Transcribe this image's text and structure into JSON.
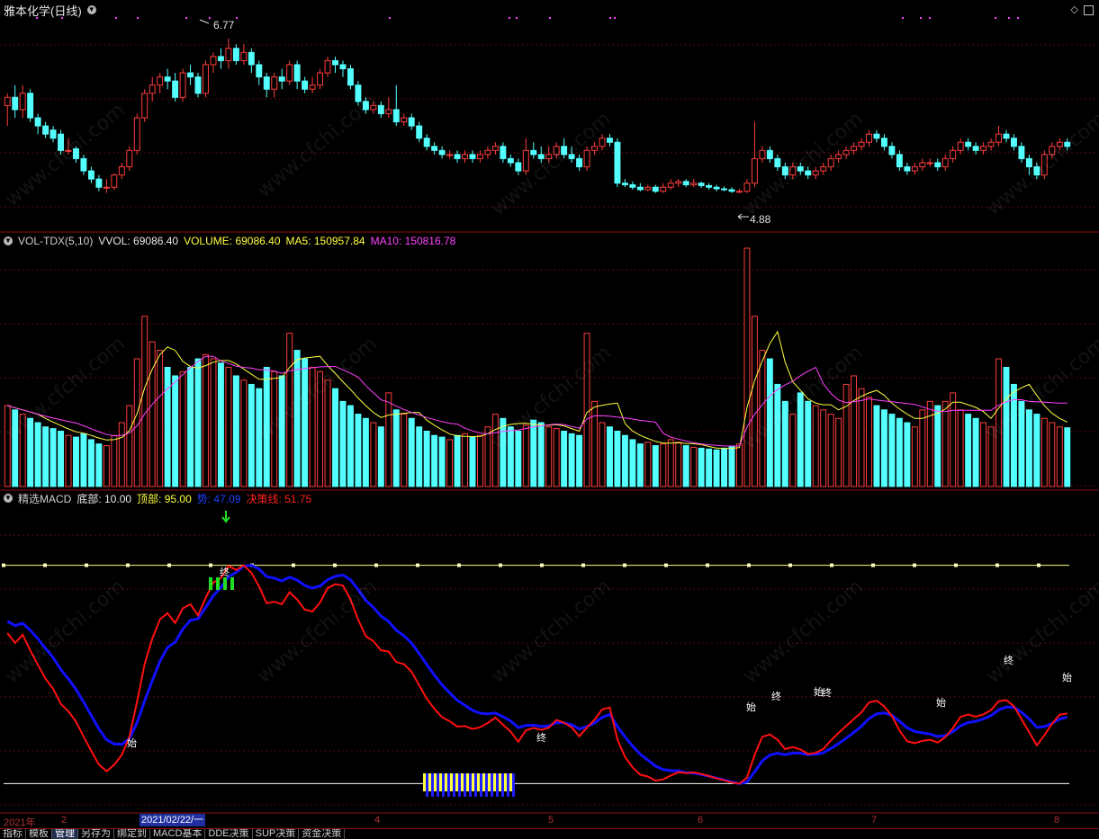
{
  "price_panel": {
    "title": "雅本化学(日线)",
    "high_label": "6.77",
    "low_label": "4.88"
  },
  "vol_panel": {
    "title": "VOL-TDX(5,10)",
    "vvol": "VVOL: 69086.40",
    "volume": "VOLUME: 69086.40",
    "ma5": "MA5: 150957.84",
    "ma10": "MA10: 150816.78"
  },
  "macd_panel": {
    "title": "精选MACD",
    "bottom": "底部: 10.00",
    "top": "顶部: 95.00",
    "trend": "势: 47.09",
    "decision": "决策线: 51.75",
    "start_mark": "始",
    "end_mark": "终"
  },
  "date_axis": {
    "labels": [
      "2021年",
      "2",
      "4",
      "5",
      "6",
      "7",
      "8"
    ],
    "selected": "2021/02/22/一"
  },
  "tabs": [
    "指标",
    "模板",
    "管理",
    "另存为",
    "绑定到",
    "MACD基本",
    "DDE决策",
    "SUP决策",
    "资金决策"
  ],
  "watermark": "www.cfchi.com",
  "colors": {
    "up": "#ff3c3c",
    "down": "#54ffff",
    "ma5": "#ffff40",
    "ma10": "#ff40ff",
    "trend": "#1010ff",
    "decision": "#ff1010",
    "axis": "#8b1010"
  },
  "chart_data": [
    {
      "type": "candlestick",
      "title": "雅本化学(日线)",
      "ylim": [
        4.6,
        7.0
      ],
      "candles": [
        [
          5.95,
          6.05,
          5.7,
          6.1
        ],
        [
          6.05,
          5.9,
          5.8,
          6.2
        ],
        [
          5.9,
          6.1,
          5.8,
          6.2
        ],
        [
          6.1,
          5.8,
          5.75,
          6.15
        ],
        [
          5.8,
          5.7,
          5.6,
          5.85
        ],
        [
          5.7,
          5.6,
          5.55,
          5.75
        ],
        [
          5.65,
          5.55,
          5.5,
          5.7
        ],
        [
          5.6,
          5.4,
          5.35,
          5.65
        ],
        [
          5.4,
          5.4,
          5.35,
          5.55
        ],
        [
          5.42,
          5.3,
          5.25,
          5.45
        ],
        [
          5.3,
          5.15,
          5.1,
          5.35
        ],
        [
          5.15,
          5.05,
          5.0,
          5.2
        ],
        [
          5.05,
          4.95,
          4.9,
          5.1
        ],
        [
          4.95,
          4.95,
          4.88,
          5.05
        ],
        [
          4.95,
          5.1,
          4.92,
          5.12
        ],
        [
          5.1,
          5.2,
          5.05,
          5.25
        ],
        [
          5.2,
          5.4,
          5.15,
          5.45
        ],
        [
          5.4,
          5.8,
          5.35,
          5.85
        ],
        [
          5.8,
          6.1,
          5.75,
          6.15
        ],
        [
          6.1,
          6.2,
          6.0,
          6.3
        ],
        [
          6.2,
          6.3,
          6.1,
          6.35
        ],
        [
          6.3,
          6.25,
          6.15,
          6.4
        ],
        [
          6.25,
          6.05,
          6.0,
          6.35
        ],
        [
          6.05,
          6.35,
          6.0,
          6.4
        ],
        [
          6.35,
          6.3,
          6.2,
          6.45
        ],
        [
          6.3,
          6.1,
          6.05,
          6.35
        ],
        [
          6.1,
          6.45,
          6.05,
          6.5
        ],
        [
          6.45,
          6.55,
          6.35,
          6.6
        ],
        [
          6.55,
          6.5,
          6.4,
          6.65
        ],
        [
          6.5,
          6.65,
          6.4,
          6.77
        ],
        [
          6.65,
          6.5,
          6.45,
          6.7
        ],
        [
          6.5,
          6.6,
          6.45,
          6.7
        ],
        [
          6.6,
          6.45,
          6.35,
          6.65
        ],
        [
          6.45,
          6.3,
          6.2,
          6.5
        ],
        [
          6.3,
          6.15,
          6.05,
          6.35
        ],
        [
          6.15,
          6.3,
          6.05,
          6.35
        ],
        [
          6.3,
          6.25,
          6.15,
          6.4
        ],
        [
          6.25,
          6.45,
          6.2,
          6.5
        ],
        [
          6.45,
          6.25,
          6.15,
          6.5
        ],
        [
          6.25,
          6.15,
          6.1,
          6.3
        ],
        [
          6.15,
          6.2,
          6.1,
          6.3
        ],
        [
          6.2,
          6.35,
          6.15,
          6.4
        ],
        [
          6.35,
          6.5,
          6.3,
          6.55
        ],
        [
          6.5,
          6.45,
          6.35,
          6.55
        ],
        [
          6.45,
          6.4,
          6.3,
          6.5
        ],
        [
          6.4,
          6.2,
          6.15,
          6.45
        ],
        [
          6.2,
          6.0,
          5.95,
          6.25
        ],
        [
          6.0,
          5.9,
          5.85,
          6.05
        ],
        [
          5.9,
          5.95,
          5.85,
          6.0
        ],
        [
          5.95,
          5.85,
          5.8,
          6.0
        ],
        [
          5.85,
          5.9,
          5.8,
          6.05
        ],
        [
          5.9,
          5.75,
          5.7,
          6.2
        ],
        [
          5.75,
          5.8,
          5.7,
          5.85
        ],
        [
          5.8,
          5.7,
          5.65,
          5.85
        ],
        [
          5.7,
          5.55,
          5.5,
          5.75
        ],
        [
          5.55,
          5.45,
          5.4,
          5.6
        ],
        [
          5.45,
          5.4,
          5.35,
          5.5
        ],
        [
          5.4,
          5.35,
          5.3,
          5.45
        ],
        [
          5.35,
          5.35,
          5.3,
          5.4
        ],
        [
          5.35,
          5.3,
          5.25,
          5.4
        ],
        [
          5.3,
          5.35,
          5.25,
          5.4
        ],
        [
          5.35,
          5.3,
          5.25,
          5.4
        ],
        [
          5.3,
          5.35,
          5.25,
          5.4
        ],
        [
          5.35,
          5.4,
          5.3,
          5.45
        ],
        [
          5.4,
          5.45,
          5.35,
          5.5
        ],
        [
          5.45,
          5.3,
          5.25,
          5.5
        ],
        [
          5.3,
          5.25,
          5.2,
          5.35
        ],
        [
          5.25,
          5.15,
          5.1,
          5.3
        ],
        [
          5.15,
          5.4,
          5.1,
          5.55
        ],
        [
          5.4,
          5.35,
          5.3,
          5.5
        ],
        [
          5.35,
          5.3,
          5.25,
          5.45
        ],
        [
          5.3,
          5.35,
          5.25,
          5.45
        ],
        [
          5.35,
          5.45,
          5.3,
          5.5
        ],
        [
          5.45,
          5.35,
          5.3,
          5.55
        ],
        [
          5.35,
          5.3,
          5.25,
          5.45
        ],
        [
          5.3,
          5.2,
          5.15,
          5.35
        ],
        [
          5.2,
          5.4,
          5.15,
          5.45
        ],
        [
          5.4,
          5.45,
          5.35,
          5.5
        ],
        [
          5.45,
          5.55,
          5.4,
          5.6
        ],
        [
          5.55,
          5.5,
          5.45,
          5.6
        ],
        [
          5.5,
          5.0,
          4.95,
          5.55
        ],
        [
          5.0,
          4.98,
          4.95,
          5.05
        ],
        [
          4.98,
          4.95,
          4.92,
          5.02
        ],
        [
          4.95,
          4.92,
          4.9,
          5.0
        ],
        [
          4.92,
          4.95,
          4.9,
          4.98
        ],
        [
          4.95,
          4.9,
          4.88,
          4.98
        ],
        [
          4.9,
          4.95,
          4.88,
          5.0
        ],
        [
          4.95,
          5.0,
          4.92,
          5.05
        ],
        [
          5.0,
          5.02,
          4.95,
          5.05
        ],
        [
          5.02,
          4.98,
          4.95,
          5.05
        ],
        [
          4.98,
          5.0,
          4.95,
          5.05
        ],
        [
          5.0,
          4.97,
          4.94,
          5.02
        ],
        [
          4.97,
          4.95,
          4.92,
          5.0
        ],
        [
          4.95,
          4.93,
          4.9,
          4.98
        ],
        [
          4.93,
          4.92,
          4.9,
          4.96
        ],
        [
          4.92,
          4.9,
          4.88,
          4.95
        ],
        [
          4.9,
          4.9,
          4.88,
          4.93
        ],
        [
          4.9,
          5.0,
          4.88,
          5.05
        ],
        [
          5.0,
          5.3,
          4.95,
          5.75
        ],
        [
          5.3,
          5.4,
          5.25,
          5.45
        ],
        [
          5.4,
          5.3,
          5.25,
          5.45
        ],
        [
          5.3,
          5.2,
          5.15,
          5.35
        ],
        [
          5.2,
          5.1,
          5.05,
          5.25
        ],
        [
          5.1,
          5.2,
          5.05,
          5.25
        ],
        [
          5.2,
          5.15,
          5.1,
          5.25
        ],
        [
          5.15,
          5.1,
          5.05,
          5.2
        ],
        [
          5.1,
          5.15,
          5.05,
          5.2
        ],
        [
          5.15,
          5.2,
          5.1,
          5.25
        ],
        [
          5.2,
          5.3,
          5.15,
          5.35
        ],
        [
          5.3,
          5.35,
          5.25,
          5.4
        ],
        [
          5.35,
          5.4,
          5.3,
          5.45
        ],
        [
          5.4,
          5.45,
          5.35,
          5.5
        ],
        [
          5.45,
          5.5,
          5.4,
          5.55
        ],
        [
          5.5,
          5.6,
          5.45,
          5.65
        ],
        [
          5.6,
          5.55,
          5.5,
          5.65
        ],
        [
          5.55,
          5.45,
          5.4,
          5.6
        ],
        [
          5.45,
          5.35,
          5.3,
          5.5
        ],
        [
          5.35,
          5.2,
          5.15,
          5.4
        ],
        [
          5.2,
          5.15,
          5.1,
          5.25
        ],
        [
          5.15,
          5.2,
          5.1,
          5.25
        ],
        [
          5.2,
          5.25,
          5.15,
          5.3
        ],
        [
          5.25,
          5.25,
          5.2,
          5.3
        ],
        [
          5.25,
          5.2,
          5.15,
          5.3
        ],
        [
          5.2,
          5.3,
          5.15,
          5.35
        ],
        [
          5.3,
          5.4,
          5.25,
          5.45
        ],
        [
          5.4,
          5.5,
          5.35,
          5.55
        ],
        [
          5.5,
          5.45,
          5.4,
          5.55
        ],
        [
          5.45,
          5.4,
          5.35,
          5.5
        ],
        [
          5.4,
          5.45,
          5.35,
          5.5
        ],
        [
          5.45,
          5.5,
          5.4,
          5.55
        ],
        [
          5.5,
          5.6,
          5.45,
          5.7
        ],
        [
          5.6,
          5.55,
          5.5,
          5.65
        ],
        [
          5.55,
          5.45,
          5.4,
          5.6
        ],
        [
          5.45,
          5.3,
          5.25,
          5.5
        ],
        [
          5.3,
          5.2,
          5.1,
          5.35
        ],
        [
          5.2,
          5.1,
          5.05,
          5.25
        ],
        [
          5.1,
          5.35,
          5.05,
          5.4
        ],
        [
          5.35,
          5.45,
          5.3,
          5.5
        ],
        [
          5.45,
          5.5,
          5.4,
          5.55
        ],
        [
          5.5,
          5.45,
          5.4,
          5.55
        ]
      ],
      "ma_lines": []
    },
    {
      "type": "bar",
      "title": "VOL-TDX(5,10)",
      "ylim": [
        0,
        280000
      ],
      "values": [
        95000,
        90000,
        85000,
        80000,
        75000,
        70000,
        68000,
        65000,
        60000,
        58000,
        62000,
        55000,
        50000,
        48000,
        60000,
        75000,
        95000,
        150000,
        200000,
        170000,
        160000,
        140000,
        130000,
        135000,
        140000,
        150000,
        155000,
        150000,
        145000,
        140000,
        130000,
        125000,
        120000,
        115000,
        140000,
        135000,
        130000,
        180000,
        160000,
        150000,
        140000,
        135000,
        125000,
        115000,
        100000,
        95000,
        85000,
        80000,
        75000,
        70000,
        110000,
        90000,
        85000,
        80000,
        70000,
        65000,
        60000,
        58000,
        55000,
        60000,
        62000,
        58000,
        60000,
        70000,
        85000,
        80000,
        70000,
        65000,
        72000,
        78000,
        75000,
        70000,
        68000,
        65000,
        62000,
        60000,
        180000,
        100000,
        75000,
        70000,
        65000,
        60000,
        55000,
        50000,
        52000,
        48000,
        50000,
        55000,
        52000,
        48000,
        46000,
        45000,
        44000,
        43000,
        45000,
        47000,
        50000,
        280000,
        200000,
        160000,
        150000,
        120000,
        100000,
        85000,
        110000,
        100000,
        95000,
        90000,
        85000,
        80000,
        120000,
        130000,
        115000,
        105000,
        95000,
        90000,
        85000,
        80000,
        75000,
        70000,
        90000,
        100000,
        95000,
        100000,
        110000,
        90000,
        85000,
        80000,
        75000,
        70000,
        150000,
        140000,
        120000,
        100000,
        90000,
        85000,
        80000,
        75000,
        70000,
        69000
      ],
      "ma5_color": "#ffff40",
      "ma10_color": "#ff40ff"
    },
    {
      "type": "line",
      "title": "精选MACD",
      "ylim": [
        0,
        105
      ],
      "series": [
        {
          "name": "势",
          "color": "#1010ff"
        },
        {
          "name": "决策线",
          "color": "#ff1010"
        }
      ],
      "baseline": 10,
      "topline": 95
    }
  ]
}
